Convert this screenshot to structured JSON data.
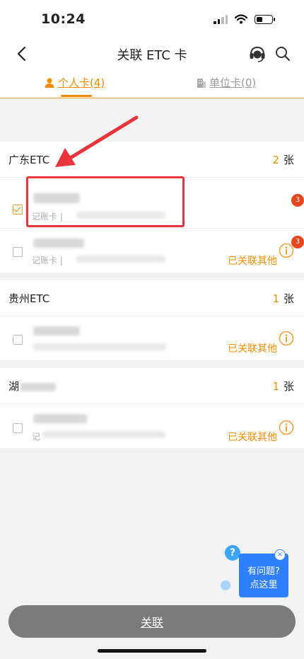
{
  "status_bar": {
    "time": "10:24"
  },
  "nav": {
    "title": "关联 ETC 卡"
  },
  "tabs": [
    {
      "label": "个人卡",
      "count": "(4)",
      "active": true
    },
    {
      "label": "单位卡",
      "count": "(0)",
      "active": false
    }
  ],
  "groups": [
    {
      "name": "广东ETC",
      "count": "2",
      "unit": "张",
      "cards": [
        {
          "type": "记账卡 |",
          "checked": true,
          "badge": "3",
          "linked_label": ""
        },
        {
          "type": "记账卡 |",
          "checked": false,
          "badge": "3",
          "linked_label": "已关联其他"
        }
      ]
    },
    {
      "name": "贵州ETC",
      "count": "1",
      "unit": "张",
      "cards": [
        {
          "type": "",
          "checked": false,
          "badge": "",
          "linked_label": "已关联其他"
        }
      ]
    },
    {
      "name": "湖",
      "count": "1",
      "unit": "张",
      "cards": [
        {
          "type": "记",
          "checked": false,
          "badge": "",
          "linked_label": "已关联其他"
        }
      ]
    }
  ],
  "help_widget": {
    "q": "?",
    "line1": "有问题?",
    "line2": "点这里",
    "close": "×"
  },
  "primary_button": {
    "label": "关联"
  },
  "colors": {
    "accent": "#f08c00",
    "highlight": "#e8343a",
    "badge": "#e8451f",
    "button": "#7b7b7b",
    "help": "#2f7fff"
  }
}
